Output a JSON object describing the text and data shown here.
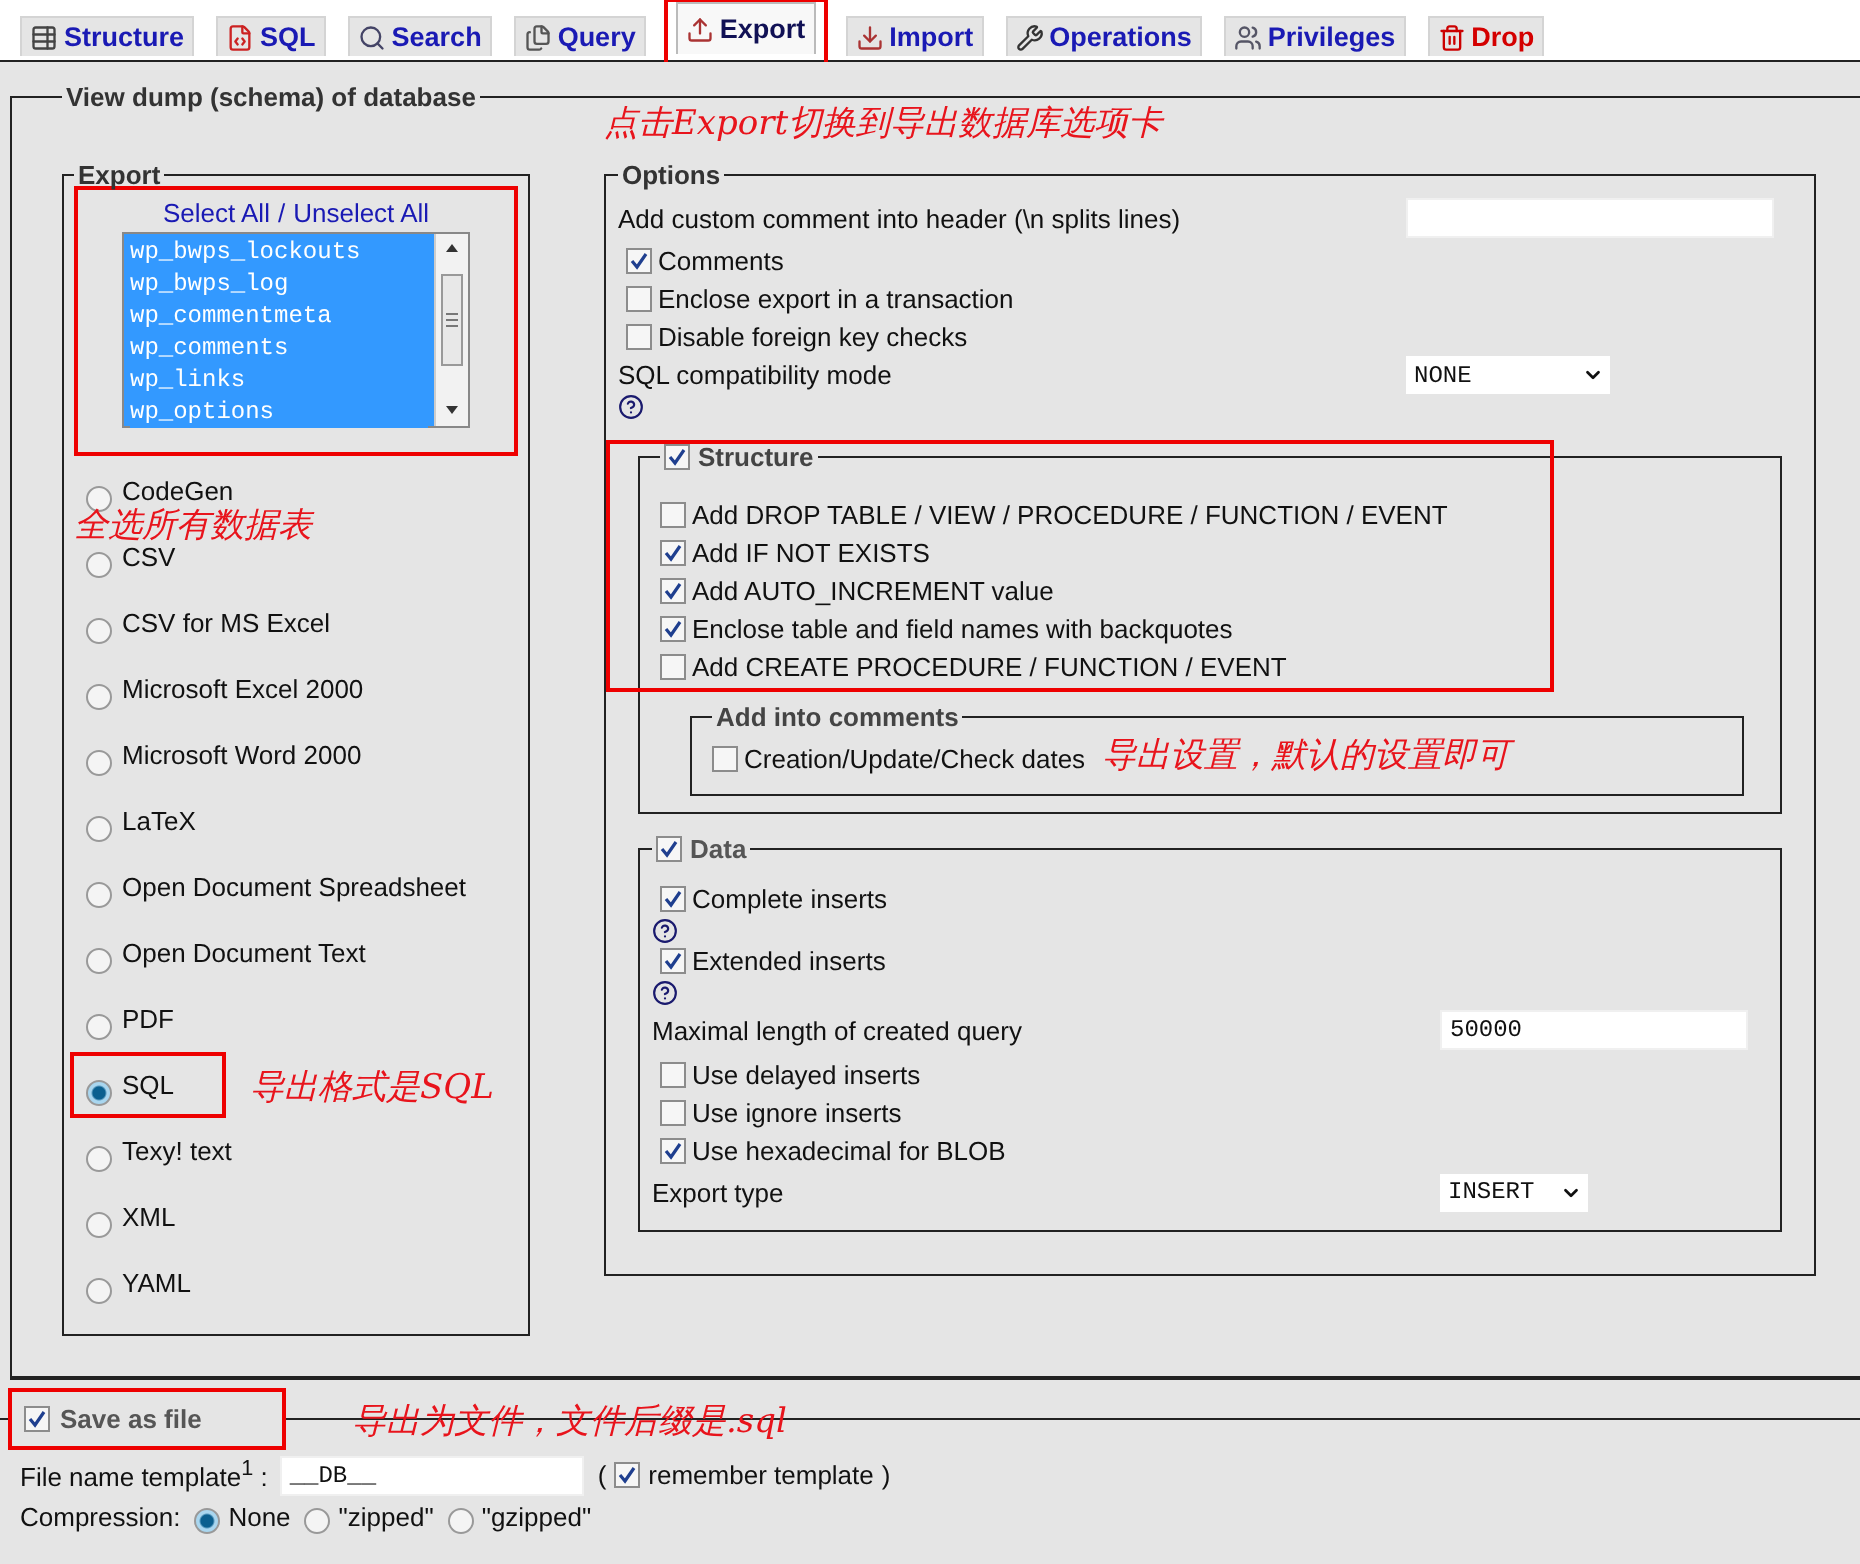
{
  "tabs": [
    {
      "label": "Structure",
      "kind": "structure",
      "selected": false,
      "highlighted": false
    },
    {
      "label": "SQL",
      "kind": "sql",
      "selected": false,
      "highlighted": false
    },
    {
      "label": "Search",
      "kind": "search",
      "selected": false,
      "highlighted": false
    },
    {
      "label": "Query",
      "kind": "query",
      "selected": false,
      "highlighted": false
    },
    {
      "label": "Export",
      "kind": "export",
      "selected": true,
      "highlighted": true
    },
    {
      "label": "Import",
      "kind": "import",
      "selected": false,
      "highlighted": false
    },
    {
      "label": "Operations",
      "kind": "operations",
      "selected": false,
      "highlighted": false
    },
    {
      "label": "Privileges",
      "kind": "privileges",
      "selected": false,
      "highlighted": false
    },
    {
      "label": "Drop",
      "kind": "drop",
      "selected": false,
      "highlighted": false
    }
  ],
  "tab_note": "点击Export切换到导出数据库选项卡",
  "dump": {
    "title": "View dump (schema) of database",
    "export": {
      "legend": "Export",
      "select_all": "Select All",
      "separator": "/",
      "unselect_all": "Unselect All",
      "highlighted": true,
      "tables": [
        {
          "name": "wp_bwps_lockouts",
          "selected": true
        },
        {
          "name": "wp_bwps_log",
          "selected": true
        },
        {
          "name": "wp_commentmeta",
          "selected": true
        },
        {
          "name": "wp_comments",
          "selected": true
        },
        {
          "name": "wp_links",
          "selected": true
        },
        {
          "name": "wp_options",
          "selected": true
        }
      ],
      "tables_note": "全选所有数据表",
      "formats": [
        {
          "label": "CodeGen",
          "selected": false,
          "highlighted": false
        },
        {
          "label": "CSV",
          "selected": false,
          "highlighted": false
        },
        {
          "label": "CSV for MS Excel",
          "selected": false,
          "highlighted": false
        },
        {
          "label": "Microsoft Excel 2000",
          "selected": false,
          "highlighted": false
        },
        {
          "label": "Microsoft Word 2000",
          "selected": false,
          "highlighted": false
        },
        {
          "label": "LaTeX",
          "selected": false,
          "highlighted": false
        },
        {
          "label": "Open Document Spreadsheet",
          "selected": false,
          "highlighted": false
        },
        {
          "label": "Open Document Text",
          "selected": false,
          "highlighted": false
        },
        {
          "label": "PDF",
          "selected": false,
          "highlighted": false
        },
        {
          "label": "SQL",
          "selected": true,
          "highlighted": true
        },
        {
          "label": "Texy! text",
          "selected": false,
          "highlighted": false
        },
        {
          "label": "XML",
          "selected": false,
          "highlighted": false
        },
        {
          "label": "YAML",
          "selected": false,
          "highlighted": false
        }
      ],
      "format_note": "导出格式是SQL"
    },
    "options": {
      "legend": "Options",
      "comment_label": "Add custom comment into header (\\n splits lines)",
      "general": [
        {
          "label": "Comments",
          "checked": true
        },
        {
          "label": "Enclose export in a transaction",
          "checked": false
        },
        {
          "label": "Disable foreign key checks",
          "checked": false
        }
      ],
      "compat_label": "SQL compatibility mode",
      "compat_value": "NONE",
      "structure": {
        "legend": "Structure",
        "checked": true,
        "highlighted": true,
        "items": [
          {
            "label": "Add DROP TABLE / VIEW / PROCEDURE / FUNCTION / EVENT",
            "checked": false
          },
          {
            "label": "Add IF NOT EXISTS",
            "checked": true
          },
          {
            "label": "Add AUTO_INCREMENT value",
            "checked": true
          },
          {
            "label": "Enclose table and field names with backquotes",
            "checked": true
          },
          {
            "label": "Add CREATE PROCEDURE / FUNCTION / EVENT",
            "checked": false
          }
        ],
        "comments_legend": "Add into comments",
        "comments_items": [
          {
            "label": "Creation/Update/Check dates",
            "checked": false
          }
        ],
        "note": "导出设置，默认的设置即可"
      },
      "data": {
        "legend": "Data",
        "checked": true,
        "rows": [
          {
            "kind": "check",
            "label": "Complete inserts",
            "checked": true
          },
          {
            "kind": "help"
          },
          {
            "kind": "check",
            "label": "Extended inserts",
            "checked": true
          },
          {
            "kind": "help"
          },
          {
            "kind": "input",
            "label": "Maximal length of created query",
            "value": "50000"
          },
          {
            "kind": "check",
            "label": "Use delayed inserts",
            "checked": false
          },
          {
            "kind": "check",
            "label": "Use ignore inserts",
            "checked": false
          },
          {
            "kind": "check",
            "label": "Use hexadecimal for BLOB",
            "checked": true
          },
          {
            "kind": "select",
            "label": "Export type",
            "value": "INSERT"
          }
        ]
      }
    }
  },
  "save": {
    "legend": "Save as file",
    "checked": true,
    "highlighted": true,
    "note": "导出为文件，文件后缀是.sql",
    "template_label": "File name template$^{1}$ :",
    "template_value": "__DB__",
    "paren_open": "(",
    "remember_label": "remember template",
    "remember_checked": true,
    "paren_close": ")",
    "compression_label": "Compression:",
    "compression": [
      {
        "label": "None",
        "selected": true
      },
      {
        "label": "\"zipped\"",
        "selected": false
      },
      {
        "label": "\"gzipped\"",
        "selected": false
      }
    ]
  }
}
